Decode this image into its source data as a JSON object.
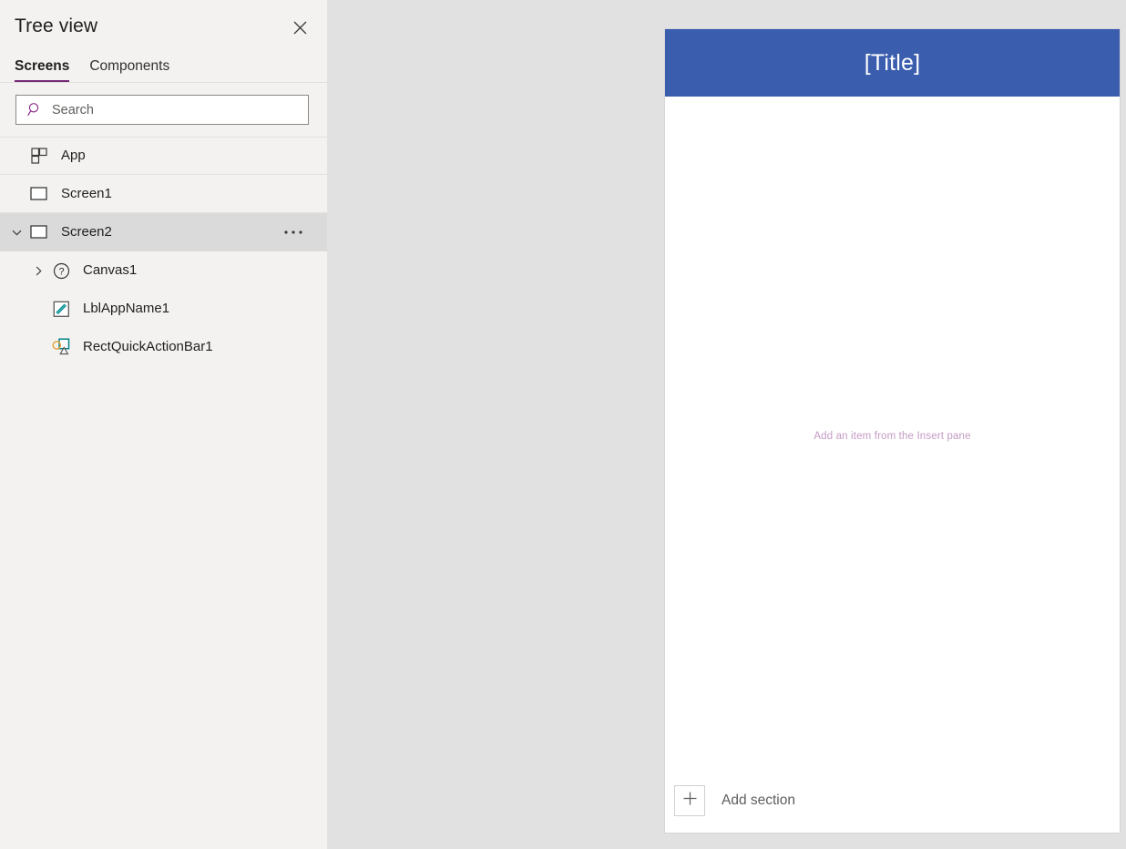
{
  "pane": {
    "title": "Tree view",
    "close_icon": "close-icon",
    "tabs": [
      {
        "label": "Screens",
        "active": true
      },
      {
        "label": "Components",
        "active": false
      }
    ],
    "search": {
      "placeholder": "Search",
      "value": "",
      "icon": "search-icon"
    },
    "tree": [
      {
        "label": "App",
        "icon": "app-grid-icon",
        "level": 0,
        "chevron": "none",
        "selected": false,
        "more": false
      },
      {
        "label": "Screen1",
        "icon": "screen-icon",
        "level": 1,
        "chevron": "none",
        "selected": false,
        "more": false
      },
      {
        "label": "Screen2",
        "icon": "screen-icon",
        "level": 1,
        "chevron": "down",
        "selected": true,
        "more": true,
        "more_label": "•••"
      },
      {
        "label": "Canvas1",
        "icon": "question-circle-icon",
        "level": 2,
        "chevron": "right",
        "selected": false,
        "more": false
      },
      {
        "label": "LblAppName1",
        "icon": "label-pencil-icon",
        "level": 2,
        "chevron": "none",
        "selected": false,
        "more": false
      },
      {
        "label": "RectQuickActionBar1",
        "icon": "shapes-icon",
        "level": 2,
        "chevron": "none",
        "selected": false,
        "more": false
      }
    ]
  },
  "canvas": {
    "title": "[Title]",
    "placeholder": "Add an item from the Insert pane",
    "add_section": {
      "label": "Add section",
      "icon": "plus-icon"
    }
  },
  "colors": {
    "accent_purple": "#742774",
    "title_bar_blue": "#3A5DAE",
    "pane_background": "#F3F2F1",
    "selected_row": "#DADADA",
    "workspace_background": "#E1E1E1",
    "placeholder_mauve": "#C39BC3"
  }
}
